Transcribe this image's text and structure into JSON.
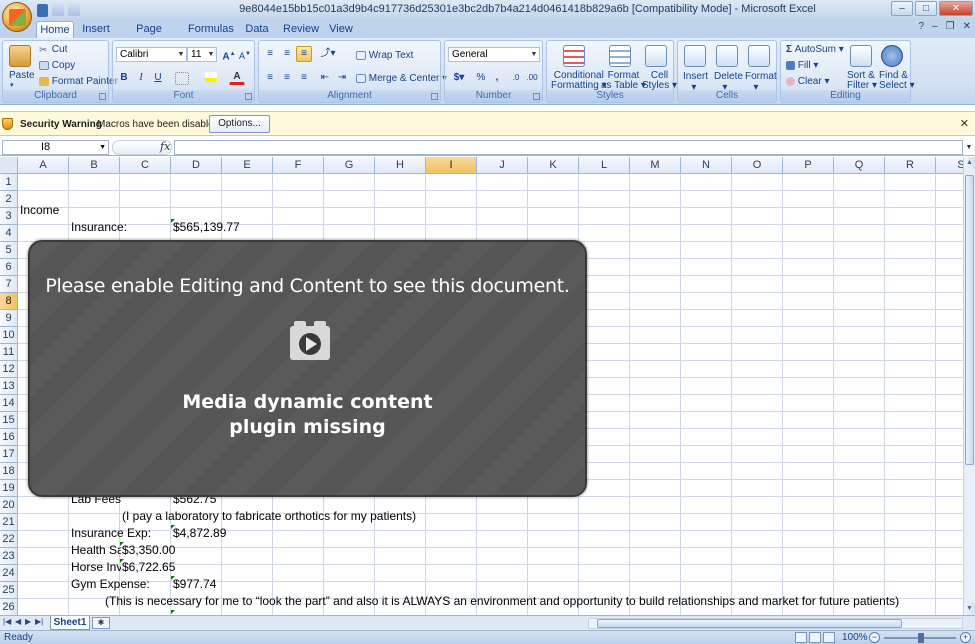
{
  "window": {
    "title": "9e8044e15bb15c01a3d9b4c917736d25301e3bc2db7b4a214d0461418b829a6b  [Compatibility Mode] - Microsoft Excel",
    "controls": [
      "–",
      "□",
      "✕"
    ]
  },
  "tabs": [
    "Home",
    "Insert",
    "Page Layout",
    "Formulas",
    "Data",
    "Review",
    "View"
  ],
  "ribbon": {
    "clipboard": {
      "label": "Clipboard",
      "paste": "Paste",
      "cut": "Cut",
      "copy": "Copy",
      "format_painter": "Format Painter"
    },
    "font": {
      "label": "Font",
      "family": "Calibri",
      "size": "11",
      "bold": "B",
      "italic": "I",
      "underline": "U"
    },
    "alignment": {
      "label": "Alignment",
      "wrap": "Wrap Text",
      "merge": "Merge & Center"
    },
    "number": {
      "label": "Number",
      "format": "General",
      "currency": "$",
      "percent": "%",
      "comma": ","
    },
    "styles": {
      "label": "Styles",
      "conditional": "Conditional",
      "conditional2": "Formatting",
      "format_table": "Format",
      "format_table2": "as Table",
      "cell_styles": "Cell",
      "cell_styles2": "Styles"
    },
    "cells": {
      "label": "Cells",
      "insert": "Insert",
      "delete": "Delete",
      "format": "Format"
    },
    "editing": {
      "label": "Editing",
      "autosum": "AutoSum",
      "fill": "Fill",
      "clear": "Clear",
      "sort": "Sort &",
      "sort2": "Filter",
      "find": "Find &",
      "find2": "Select"
    }
  },
  "security": {
    "title": "Security Warning",
    "message": "Macros have been disabled.",
    "options": "Options..."
  },
  "formula_bar": {
    "name_box": "I8",
    "fx": "fx",
    "formula": ""
  },
  "columns": [
    "A",
    "B",
    "C",
    "D",
    "E",
    "F",
    "G",
    "H",
    "I",
    "J",
    "K",
    "L",
    "M",
    "N",
    "O",
    "P",
    "Q",
    "R",
    "S"
  ],
  "rows": [
    "1",
    "2",
    "3",
    "4",
    "5",
    "6",
    "7",
    "8",
    "9",
    "10",
    "11",
    "12",
    "13",
    "14",
    "15",
    "16",
    "17",
    "18",
    "19",
    "20",
    "21",
    "22",
    "23",
    "24",
    "25",
    "26"
  ],
  "cells": {
    "a3": "Income",
    "b4": "Insurance:",
    "d4": "$565,139.77",
    "b20": "Lab Fees",
    "d20": "$562.75",
    "c21": "(I pay a laboratory to fabricate orthotics for my patients)",
    "b22": "Insurance Exp:",
    "d22": "$4,872.89",
    "b23": "Health Sa",
    "c23": "$3,350.00",
    "b24": "Horse Inv",
    "c24": "$6,722.65",
    "b25": "Gym Expense:",
    "d25": "$977.74",
    "b26": "(This is necessary for me to “look the part” and also it is ALWAYS an environment and opportunity to build relationships and market for future patients)"
  },
  "overlay": {
    "message": "Please enable Editing and Content to see this document.",
    "plugin_line1": "Media dynamic content",
    "plugin_line2": "plugin missing",
    "icon": "play-icon"
  },
  "sheet": {
    "tab": "Sheet1"
  },
  "status": {
    "ready": "Ready",
    "zoom": "100%"
  }
}
